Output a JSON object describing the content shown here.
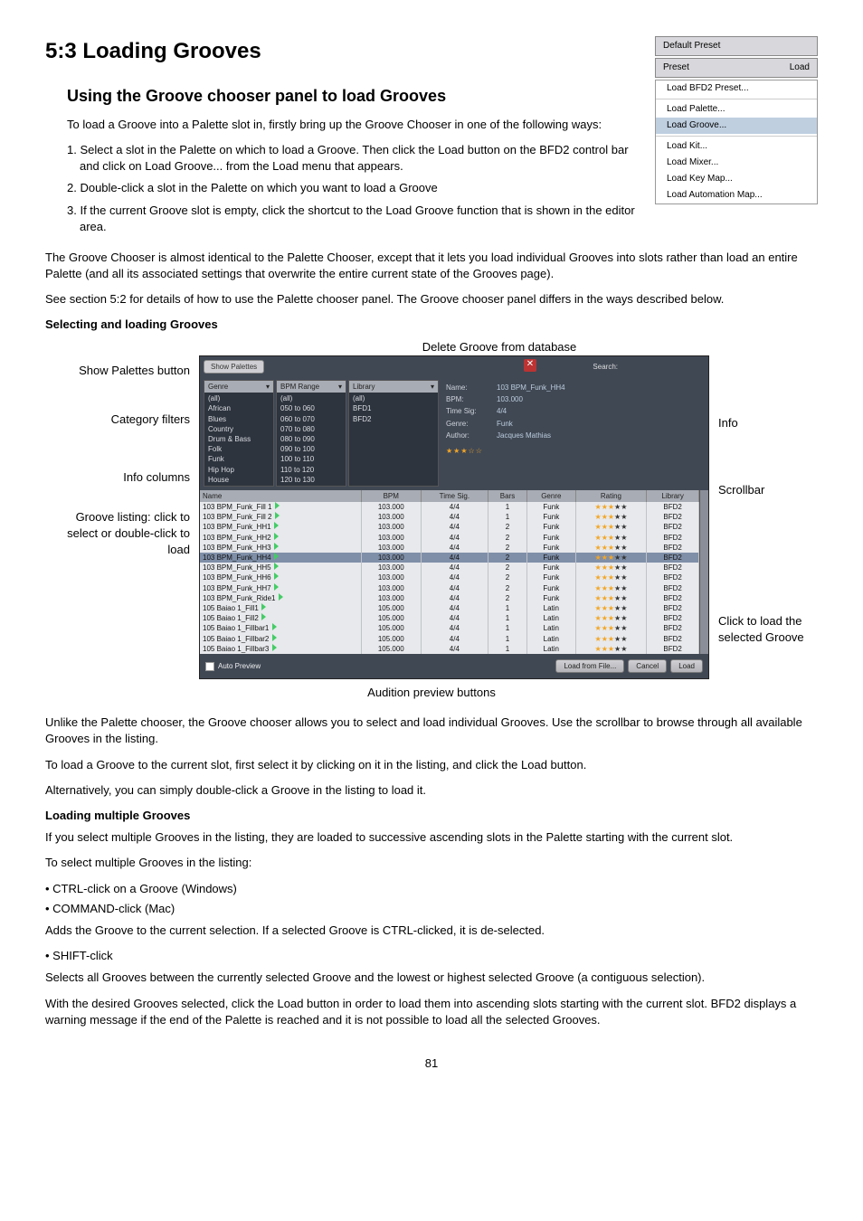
{
  "title": "5:3 Loading Grooves",
  "h2_1": "Using the Groove chooser panel to load Grooves",
  "intro1": "To load a Groove into a Palette slot in, firstly bring up the Groove Chooser in one of the following ways:",
  "step1": "1. Select a slot in the Palette on which to load a Groove. Then click the Load button on the BFD2 control bar and click on Load Groove... from the Load menu that appears.",
  "step2": "2. Double-click a slot in the Palette on which you want to load a Groove",
  "step3": "3. If the current Groove slot is empty, click the shortcut to the Load Groove function that is shown in the editor area.",
  "para1": "The Groove Chooser is almost identical to the Palette Chooser, except that it lets you load individual Grooves into slots rather than load an entire Palette (and all its associated settings that overwrite the entire current state of the Grooves page).",
  "para2": "See section 5:2 for details of how to use the Palette chooser panel. The Groove chooser panel differs in the ways described below.",
  "h3_selecting": "Selecting and loading Grooves",
  "annots": {
    "delete": "Delete Groove from database",
    "show_palettes": "Show Palettes button",
    "category": "Category filters",
    "info_cols": "Info columns",
    "groove_listing": "Groove listing: click to select or double-click to load",
    "scrollbar": "Scrollbar",
    "info": "Info",
    "click_load": "Click to load the selected Groove",
    "audition": "Audition preview buttons"
  },
  "menu": {
    "default_preset": "Default Preset",
    "preset": "Preset",
    "load": "Load",
    "items": [
      "Load BFD2 Preset...",
      "Load Palette...",
      "Load Groove...",
      "Load Kit...",
      "Load Mixer...",
      "Load Key Map...",
      "Load Automation Map..."
    ]
  },
  "chooser": {
    "show_palettes": "Show Palettes",
    "search": "Search:",
    "filters": {
      "genre": "Genre",
      "bpm_range": "BPM Range",
      "library": "Library",
      "genres": [
        "(all)",
        "African",
        "Blues",
        "Country",
        "Drum & Bass",
        "Folk",
        "Funk",
        "Hip Hop",
        "House"
      ],
      "bpms": [
        "(all)",
        "050 to 060",
        "060 to 070",
        "070 to 080",
        "080 to 090",
        "090 to 100",
        "100 to 110",
        "110 to 120",
        "120 to 130"
      ],
      "libs": [
        "(all)",
        "BFD1",
        "BFD2"
      ]
    },
    "info": {
      "name_k": "Name:",
      "name_v": "103 BPM_Funk_HH4",
      "bpm_k": "BPM:",
      "bpm_v": "103.000",
      "timesig_k": "Time Sig:",
      "timesig_v": "4/4",
      "genre_k": "Genre:",
      "genre_v": "Funk",
      "author_k": "Author:",
      "author_v": "Jacques Mathias",
      "rating": "★★★☆☆"
    },
    "cols": [
      "Name",
      "BPM",
      "Time Sig.",
      "Bars",
      "Genre",
      "Rating",
      "Library"
    ],
    "rows": [
      {
        "name": "103 BPM_Funk_Fill 1",
        "bpm": "103.000",
        "ts": "4/4",
        "bars": "1",
        "genre": "Funk",
        "lib": "BFD2"
      },
      {
        "name": "103 BPM_Funk_Fill 2",
        "bpm": "103.000",
        "ts": "4/4",
        "bars": "1",
        "genre": "Funk",
        "lib": "BFD2"
      },
      {
        "name": "103 BPM_Funk_HH1",
        "bpm": "103.000",
        "ts": "4/4",
        "bars": "2",
        "genre": "Funk",
        "lib": "BFD2"
      },
      {
        "name": "103 BPM_Funk_HH2",
        "bpm": "103.000",
        "ts": "4/4",
        "bars": "2",
        "genre": "Funk",
        "lib": "BFD2"
      },
      {
        "name": "103 BPM_Funk_HH3",
        "bpm": "103.000",
        "ts": "4/4",
        "bars": "2",
        "genre": "Funk",
        "lib": "BFD2"
      },
      {
        "name": "103 BPM_Funk_HH4",
        "bpm": "103.000",
        "ts": "4/4",
        "bars": "2",
        "genre": "Funk",
        "lib": "BFD2",
        "sel": true
      },
      {
        "name": "103 BPM_Funk_HH5",
        "bpm": "103.000",
        "ts": "4/4",
        "bars": "2",
        "genre": "Funk",
        "lib": "BFD2"
      },
      {
        "name": "103 BPM_Funk_HH6",
        "bpm": "103.000",
        "ts": "4/4",
        "bars": "2",
        "genre": "Funk",
        "lib": "BFD2"
      },
      {
        "name": "103 BPM_Funk_HH7",
        "bpm": "103.000",
        "ts": "4/4",
        "bars": "2",
        "genre": "Funk",
        "lib": "BFD2"
      },
      {
        "name": "103 BPM_Funk_Ride1",
        "bpm": "103.000",
        "ts": "4/4",
        "bars": "2",
        "genre": "Funk",
        "lib": "BFD2"
      },
      {
        "name": "105 Baiao 1_Fill1",
        "bpm": "105.000",
        "ts": "4/4",
        "bars": "1",
        "genre": "Latin",
        "lib": "BFD2"
      },
      {
        "name": "105 Baiao 1_Fill2",
        "bpm": "105.000",
        "ts": "4/4",
        "bars": "1",
        "genre": "Latin",
        "lib": "BFD2"
      },
      {
        "name": "105 Baiao 1_Fillbar1",
        "bpm": "105.000",
        "ts": "4/4",
        "bars": "1",
        "genre": "Latin",
        "lib": "BFD2"
      },
      {
        "name": "105 Baiao 1_Fillbar2",
        "bpm": "105.000",
        "ts": "4/4",
        "bars": "1",
        "genre": "Latin",
        "lib": "BFD2"
      },
      {
        "name": "105 Baiao 1_Fillbar3",
        "bpm": "105.000",
        "ts": "4/4",
        "bars": "1",
        "genre": "Latin",
        "lib": "BFD2"
      }
    ],
    "auto_preview": "Auto Preview",
    "btn_load_file": "Load from File...",
    "btn_cancel": "Cancel",
    "btn_load": "Load"
  },
  "after1": "Unlike the Palette chooser, the Groove chooser allows you to select and load individual Grooves. Use the scrollbar to browse through all available Grooves in the listing.",
  "after2": "To load a Groove to the current slot, first select it by clicking on it in the listing, and click the Load button.",
  "after3": "Alternatively, you can simply double-click a Groove in the listing to load it.",
  "h3_multi": "Loading multiple Grooves",
  "multi1": "If you select multiple Grooves in the listing, they are loaded to successive ascending slots in the Palette starting with the current slot.",
  "multi2": "To select multiple Grooves in the listing:",
  "bul1": "• CTRL-click on a Groove (Windows)",
  "bul2": "• COMMAND-click (Mac)",
  "multi3": "Adds the Groove to the current selection. If a selected Groove is CTRL-clicked, it is de-selected.",
  "bul3": "• SHIFT-click",
  "multi4": "Selects all Grooves between the currently selected Groove and the lowest or highest selected Groove (a contiguous selection).",
  "multi5": "With the desired Grooves selected, click the Load button in order to load them into ascending slots starting with the current slot. BFD2 displays a warning message if the end of the Palette is reached and it is not possible to load all the selected Grooves.",
  "page_num": "81"
}
